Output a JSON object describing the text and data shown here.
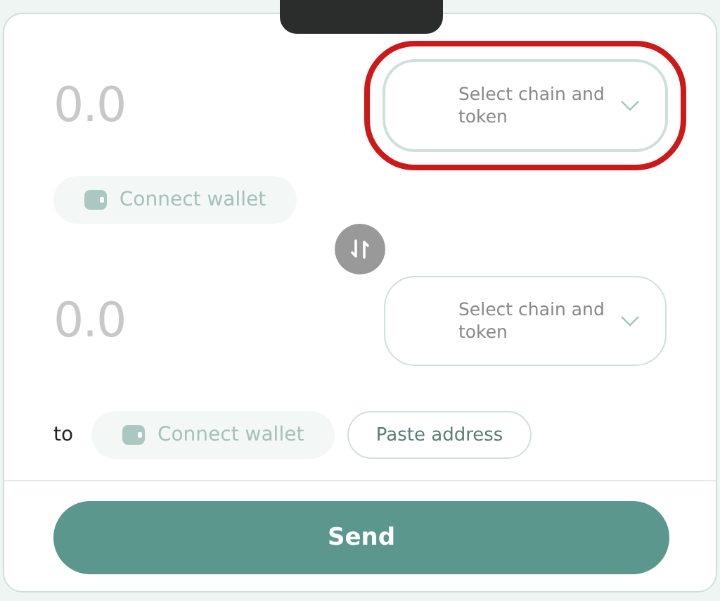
{
  "source": {
    "amount_placeholder": "0.0",
    "token_select": {
      "label": "Select chain and token",
      "highlighted": true
    },
    "wallet_button": {
      "label": "Connect wallet",
      "disabled": true
    }
  },
  "destination": {
    "amount_placeholder": "0.0",
    "token_select": {
      "label": "Select chain and token",
      "highlighted": false
    }
  },
  "recipient": {
    "prefix": "to",
    "wallet_button": {
      "label": "Connect wallet",
      "disabled": true
    },
    "paste_button": {
      "label": "Paste address"
    }
  },
  "send_button": {
    "label": "Send"
  }
}
